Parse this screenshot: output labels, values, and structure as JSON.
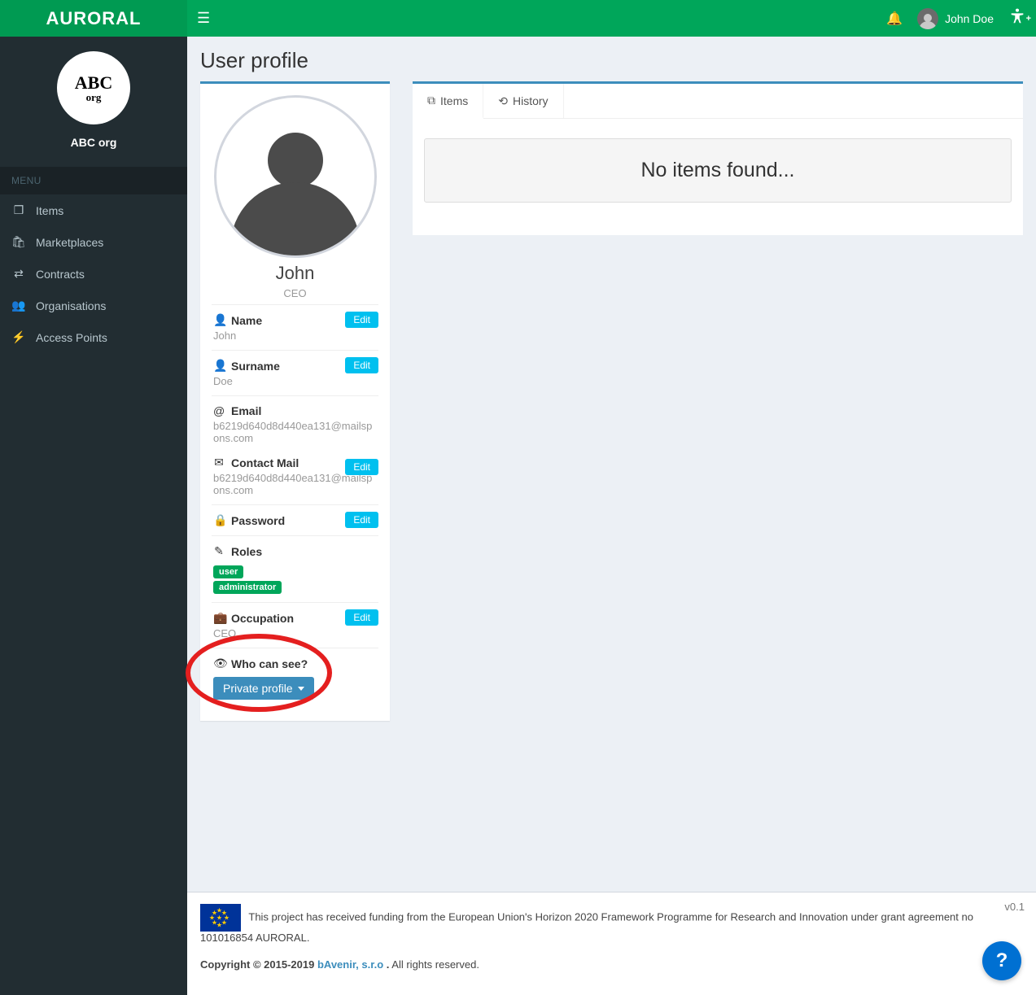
{
  "brand": "AURORAL",
  "header": {
    "user_name": "John Doe"
  },
  "sidebar": {
    "org_logo_line1": "ABC",
    "org_logo_line2": "org",
    "org_name": "ABC org",
    "menu_header": "MENU",
    "items": [
      {
        "label": "Items"
      },
      {
        "label": "Marketplaces"
      },
      {
        "label": "Contracts"
      },
      {
        "label": "Organisations"
      },
      {
        "label": "Access Points"
      }
    ]
  },
  "page": {
    "title": "User profile"
  },
  "profile": {
    "display_name": "John",
    "display_role": "CEO",
    "fields": {
      "name": {
        "label": "Name",
        "value": "John",
        "edit": "Edit"
      },
      "surname": {
        "label": "Surname",
        "value": "Doe",
        "edit": "Edit"
      },
      "email": {
        "label": "Email",
        "value": "b6219d640d8d440ea131@mailspons.com"
      },
      "contact": {
        "label": "Contact Mail",
        "value": "b6219d640d8d440ea131@mailspons.com",
        "edit": "Edit"
      },
      "password": {
        "label": "Password",
        "edit": "Edit"
      },
      "roles": {
        "label": "Roles",
        "badges": [
          "user",
          "administrator"
        ]
      },
      "occupation": {
        "label": "Occupation",
        "value": "CEO",
        "edit": "Edit"
      },
      "visibility": {
        "label": "Who can see?",
        "button": "Private profile"
      }
    }
  },
  "tabs": {
    "items": {
      "label": "Items"
    },
    "history": {
      "label": "History"
    },
    "empty_message": "No items found..."
  },
  "footer": {
    "funding_text": "This project has received funding from the European Union's Horizon 2020 Framework Programme for Research and Innovation under grant agreement no 101016854 AURORAL.",
    "copyright_prefix": "Copyright © 2015-2019 ",
    "company": "bAvenir, s.r.o",
    "copyright_suffix": " All rights reserved.",
    "version": "v0.1"
  },
  "help": "?"
}
